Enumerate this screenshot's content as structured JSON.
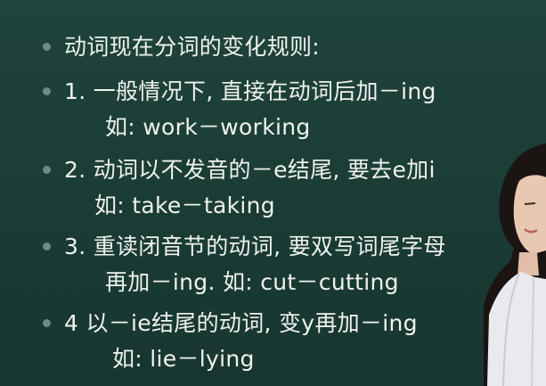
{
  "slide": {
    "lines": [
      "动词现在分词的变化规则:",
      "1. 一般情况下, 直接在动词后加－ing",
      "如: work－working",
      "2. 动词以不发音的－e结尾, 要去e加i",
      "如: take－taking",
      "3. 重读闭音节的动词, 要双写词尾字母",
      "再加－ing. 如: cut－cutting",
      "4 以－ie结尾的动词, 变y再加－ing",
      "如: lie－lying"
    ]
  }
}
